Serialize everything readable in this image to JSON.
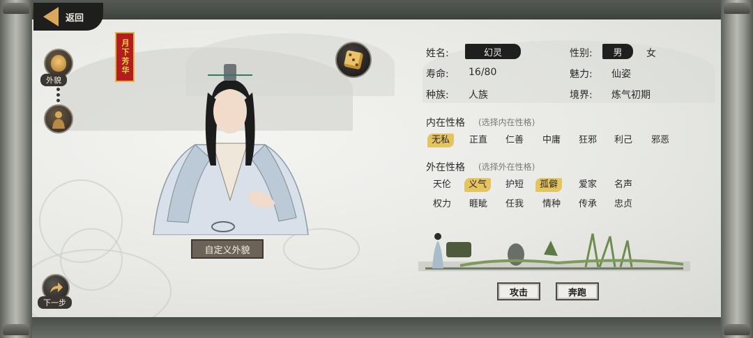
{
  "nav": {
    "back_label": "返回"
  },
  "seal": {
    "text": "月下芳华"
  },
  "appearance": {
    "label": "外貌"
  },
  "custom_appearance_label": "自定义外貌",
  "next_step_label": "下一步",
  "profile": {
    "name_label": "姓名:",
    "name_value": "幻灵",
    "lifespan_label": "寿命:",
    "lifespan_value": "16/80",
    "race_label": "种族:",
    "race_value": "人族",
    "gender_label": "性别:",
    "gender_selected": "男",
    "gender_other": "女",
    "charm_label": "魅力:",
    "charm_value": "仙姿",
    "realm_label": "境界:",
    "realm_value": "炼气初期"
  },
  "inner_personality": {
    "title": "内在性格",
    "hint": "(选择内在性格)",
    "options": [
      "无私",
      "正直",
      "仁善",
      "中庸",
      "狂邪",
      "利己",
      "邪恶"
    ],
    "selected": [
      "无私"
    ]
  },
  "outer_personality": {
    "title": "外在性格",
    "hint": "(选择外在性格)",
    "row1": [
      "天伦",
      "义气",
      "护短",
      "孤僻",
      "爱家",
      "名声"
    ],
    "row2": [
      "权力",
      "睚眦",
      "任我",
      "情种",
      "传承",
      "忠贞"
    ],
    "selected": [
      "义气",
      "孤僻"
    ]
  },
  "actions": {
    "attack_label": "攻击",
    "flee_label": "奔跑"
  },
  "colors": {
    "accent_gold": "#e5c35f",
    "seal_red": "#b31d1d",
    "ink": "#1f1f1f"
  },
  "icons": [
    "back-arrow-icon",
    "face-portrait-icon",
    "figure-portrait-icon",
    "dice-icon",
    "next-arrow-icon"
  ]
}
